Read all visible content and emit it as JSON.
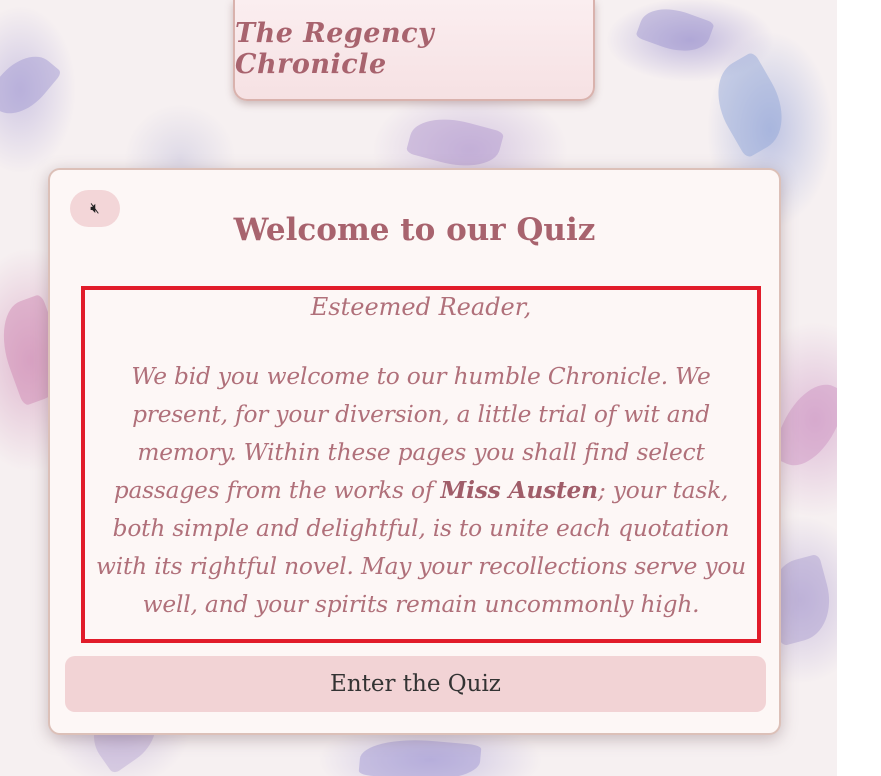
{
  "header": {
    "title": "The Regency Chronicle"
  },
  "card": {
    "mute_icon": "speaker-muted-icon",
    "heading": "Welcome to our Quiz",
    "letter": {
      "salutation": "Esteemed Reader,",
      "body_before": "We bid you welcome to our humble Chronicle. We present, for your diversion, a little trial of wit and memory. Within these pages you shall find select passages from the works of ",
      "body_emphasis": "Miss Austen",
      "body_after": "; your task, both simple and delightful, is to unite each quotation with its rightful novel. May your recollections serve you well, and your spirits remain uncommonly high."
    },
    "enter_button": "Enter the Quiz"
  },
  "colors": {
    "accent_rose": "#a8636e",
    "highlight_border": "#e11c2a",
    "button_pink": "#f2d3d5",
    "card_bg": "#fdf7f6"
  }
}
